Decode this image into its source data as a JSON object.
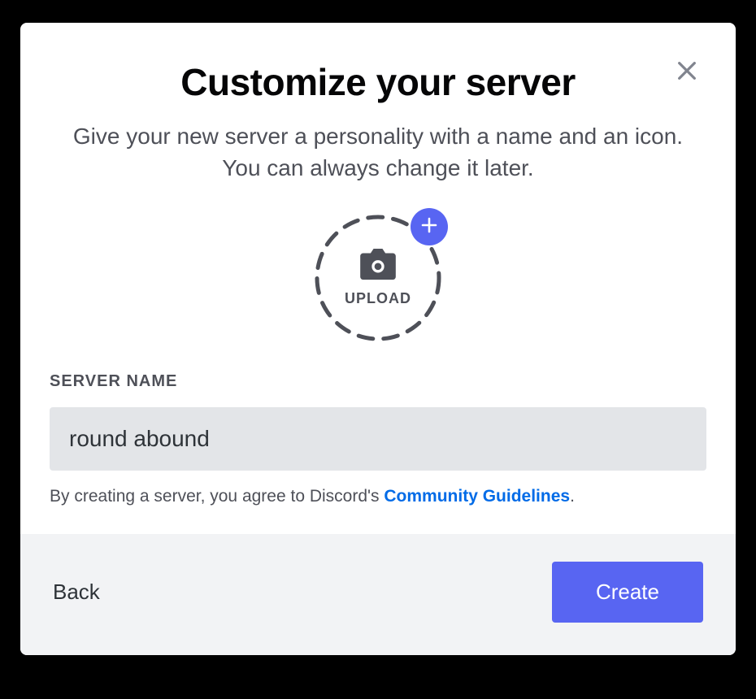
{
  "modal": {
    "title": "Customize your server",
    "subtitle": "Give your new server a personality with a name and an icon. You can always change it later.",
    "upload_label": "UPLOAD",
    "field_label": "SERVER NAME",
    "server_name_value": "round abound",
    "legal_prefix": "By creating a server, you agree to Discord's ",
    "legal_link": "Community Guidelines",
    "legal_suffix": ".",
    "back_label": "Back",
    "create_label": "Create"
  }
}
